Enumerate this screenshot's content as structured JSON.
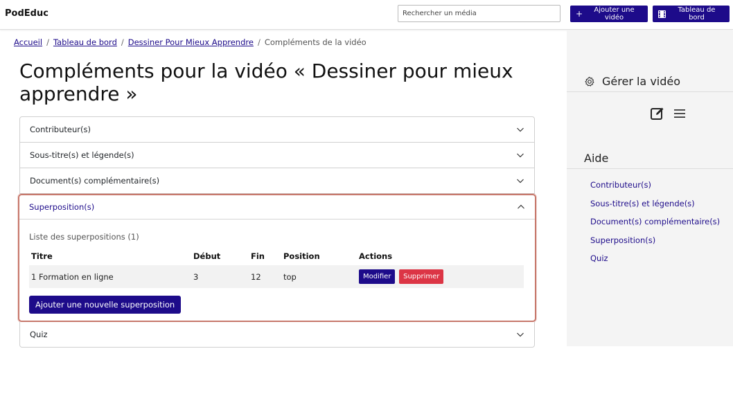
{
  "header": {
    "brand": "PodEduc",
    "search_placeholder": "Rechercher un média",
    "add_video_label": "Ajouter une vidéo",
    "dashboard_label": "Tableau de bord"
  },
  "breadcrumb": {
    "items": [
      "Accueil",
      "Tableau de bord",
      "Dessiner Pour Mieux Apprendre"
    ],
    "current": "Compléments de la vidéo",
    "separator": "/"
  },
  "page_title": "Compléments pour la vidéo « Dessiner pour mieux apprendre »",
  "accordion": {
    "sections": [
      "Contributeur(s)",
      "Sous-titre(s) et légende(s)",
      "Document(s) complémentaire(s)",
      "Superposition(s)",
      "Quiz"
    ],
    "open_section": "Superposition(s)",
    "overlays": {
      "caption": "Liste des superpositions (1)",
      "columns": [
        "Titre",
        "Début",
        "Fin",
        "Position",
        "Actions"
      ],
      "rows": [
        {
          "title": "1 Formation en ligne",
          "start": "3",
          "end": "12",
          "position": "top"
        }
      ],
      "edit_label": "Modifier",
      "delete_label": "Supprimer",
      "add_label": "Ajouter une nouvelle superposition"
    }
  },
  "sidebar": {
    "manage_title": "Gérer la vidéo",
    "help_title": "Aide",
    "help_links": [
      "Contributeur(s)",
      "Sous-titre(s) et légende(s)",
      "Document(s) complémentaire(s)",
      "Superposition(s)",
      "Quiz"
    ]
  },
  "colors": {
    "primary": "#1d0b8a",
    "danger": "#dc3545",
    "focus_outline": "#c7776b",
    "sidebar_bg": "#f4f4f4"
  },
  "icons": [
    "plus-icon",
    "film-icon",
    "chevron-down-icon",
    "chevron-up-icon",
    "gear-icon",
    "edit-icon",
    "menu-icon"
  ]
}
